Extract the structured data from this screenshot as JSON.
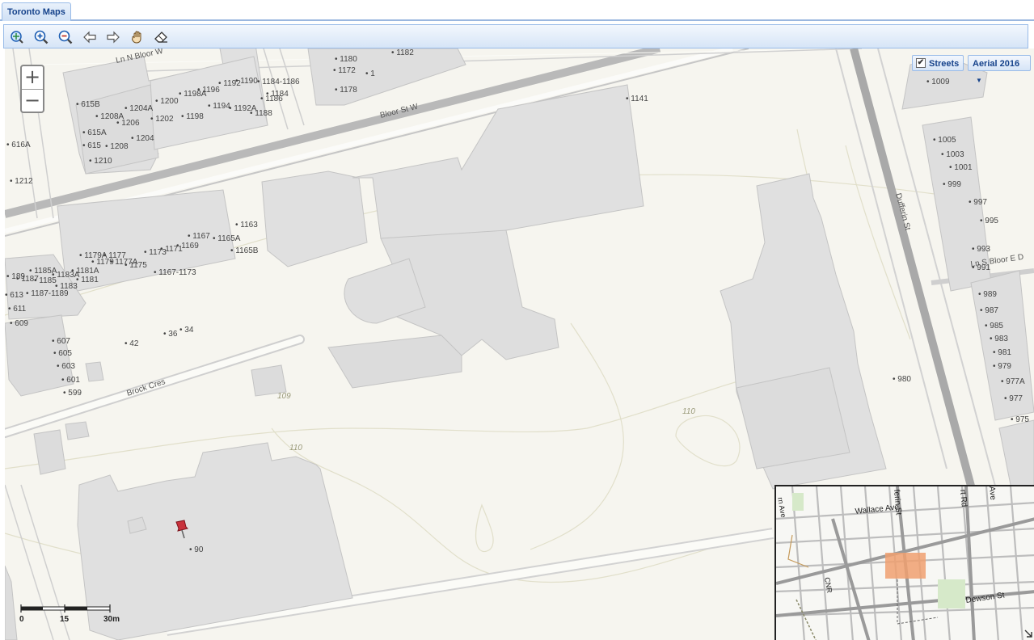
{
  "tab": {
    "title": "Toronto Maps"
  },
  "toolbar": {
    "tools": [
      "full-extent",
      "zoom-in",
      "zoom-out",
      "previous-extent",
      "next-extent",
      "pan",
      "clear"
    ]
  },
  "layers": {
    "streets_label": "Streets",
    "streets_checked": true,
    "basemap_label": "Aerial 2016"
  },
  "zoom": {
    "plus": "+",
    "minus": "−"
  },
  "scale": {
    "labels": [
      "0",
      "15",
      "30m"
    ]
  },
  "streets": {
    "ln_n_bloor": "Ln N Bloor W",
    "bloor": "Bloor St W",
    "dufferin": "Dufferin St",
    "brock": "Brock Cres",
    "ln_s_bloor": "Ln S Bloor E D"
  },
  "contours": [
    "109",
    "110",
    "110"
  ],
  "addresses": [
    "1180",
    "1172",
    "1",
    "1178",
    "1182",
    "1141",
    "1198A",
    "1196",
    "1192",
    "1190",
    "1184-1186",
    "1184",
    "1186",
    "615B",
    "1204A",
    "1200",
    "1194",
    "1192A",
    "1188",
    "1208A",
    "1206",
    "1202",
    "1198",
    "615A",
    "1204",
    "615",
    "1208",
    "1210",
    "616A",
    "1212",
    "1163",
    "1167",
    "1165A",
    "1165B",
    "1169",
    "1171",
    "1173",
    "1175",
    "1167-1173",
    "1179A",
    "1177",
    "1179",
    "1177A",
    "1185A",
    "1183A",
    "1181A",
    "1187",
    "1185",
    "1181",
    "1183",
    "189",
    "613",
    "1187-1189",
    "611",
    "609",
    "607",
    "605",
    "603",
    "601",
    "599",
    "42",
    "36",
    "34",
    "90",
    "980",
    "1009",
    "1005",
    "1003",
    "1001",
    "999",
    "997",
    "995",
    "993",
    "991",
    "989",
    "987",
    "985",
    "983",
    "981",
    "979",
    "977A",
    "977",
    "975"
  ],
  "overview": {
    "wallace": "Wallace Ave",
    "dufferin": "ferin St",
    "rd": "rt Rd",
    "ave": "Ave",
    "dewson": "Dewson St",
    "cnr": "CNR",
    "rn_ave": "rn Ave"
  }
}
